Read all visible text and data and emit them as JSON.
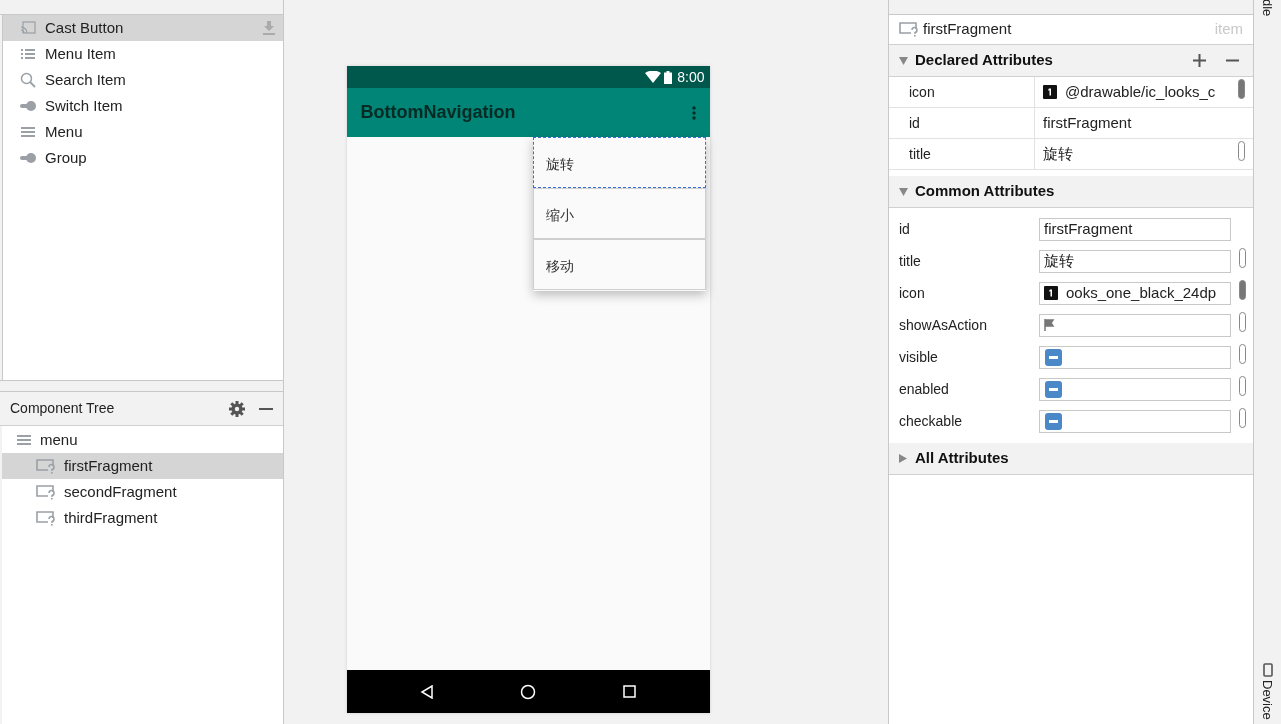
{
  "palette": {
    "items": [
      {
        "label": "Cast Button",
        "kind": "cast",
        "selected": true,
        "download": true
      },
      {
        "label": "Menu Item",
        "kind": "list",
        "selected": false,
        "download": false
      },
      {
        "label": "Search Item",
        "kind": "search",
        "selected": false,
        "download": false
      },
      {
        "label": "Switch Item",
        "kind": "switch",
        "selected": false,
        "download": false
      },
      {
        "label": "Menu",
        "kind": "menu",
        "selected": false,
        "download": false
      },
      {
        "label": "Group",
        "kind": "switch",
        "selected": false,
        "download": false
      }
    ]
  },
  "component_tree": {
    "title": "Component Tree",
    "items": [
      {
        "label": "menu",
        "kind": "menu",
        "selected": false,
        "children": [
          {
            "label": "firstFragment",
            "kind": "item",
            "selected": true
          },
          {
            "label": "secondFragment",
            "kind": "item",
            "selected": false
          },
          {
            "label": "thirdFragment",
            "kind": "item",
            "selected": false
          }
        ]
      }
    ]
  },
  "phone": {
    "time": "8:00",
    "app_title": "BottomNavigation",
    "menu_items": [
      {
        "label": "旋转",
        "selected": true
      },
      {
        "label": "缩小",
        "selected": false
      },
      {
        "label": "移动",
        "selected": false
      }
    ]
  },
  "attributes": {
    "component": "firstFragment",
    "component_type": "item",
    "sections": [
      {
        "title": "Declared Attributes",
        "expanded": true,
        "kind": "declared",
        "rows": [
          {
            "name": "icon",
            "value": "@drawable/ic_looks_c",
            "kind": "drawable"
          },
          {
            "name": "id",
            "value": "firstFragment",
            "kind": "text"
          },
          {
            "name": "title",
            "value": "旋转",
            "kind": "text"
          }
        ]
      },
      {
        "title": "Common Attributes",
        "expanded": true,
        "kind": "common",
        "rows": [
          {
            "name": "id",
            "value": "firstFragment",
            "kind": "text"
          },
          {
            "name": "title",
            "value": "旋转",
            "kind": "text"
          },
          {
            "name": "icon",
            "value": "ooks_one_black_24dp",
            "kind": "drawable"
          },
          {
            "name": "showAsAction",
            "kind": "flag"
          },
          {
            "name": "visible",
            "kind": "tristate",
            "indeterminate": true
          },
          {
            "name": "enabled",
            "kind": "tristate",
            "indeterminate": true
          },
          {
            "name": "checkable",
            "kind": "tristate",
            "indeterminate": true
          }
        ]
      },
      {
        "title": "All Attributes",
        "expanded": false,
        "kind": "all"
      }
    ]
  },
  "side_tabs": [
    {
      "label": "dle"
    },
    {
      "label": "Device"
    }
  ]
}
